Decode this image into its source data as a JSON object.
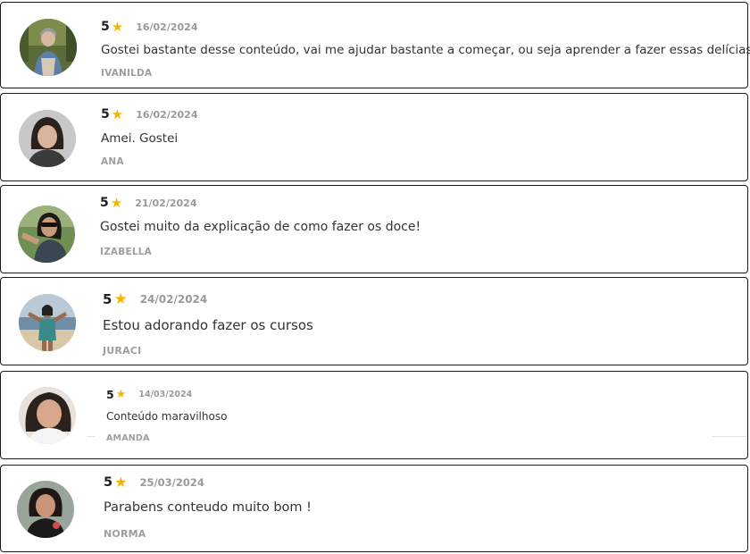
{
  "reviews": [
    {
      "rating": "5",
      "date": "16/02/2024",
      "text": "Gostei bastante desse conteúdo, vai me ajudar bastante a começar, ou seja aprender a fazer essas delícias",
      "author": "IVANILDA",
      "star_icon": "star-icon",
      "star_color": "#f4b400"
    },
    {
      "rating": "5",
      "date": "16/02/2024",
      "text": "Amei. Gostei",
      "author": "ANA",
      "star_icon": "star-icon",
      "star_color": "#f4b400"
    },
    {
      "rating": "5",
      "date": "21/02/2024",
      "text": "Gostei muito da explicação de como fazer os doce!",
      "author": "IZABELLA",
      "star_icon": "star-icon",
      "star_color": "#f4b400"
    },
    {
      "rating": "5",
      "date": "24/02/2024",
      "text": "Estou adorando fazer os cursos",
      "author": "JURACI",
      "star_icon": "star-icon",
      "star_color": "#f4b400"
    },
    {
      "rating": "5",
      "date": "14/03/2024",
      "text": "Conteúdo maravilhoso",
      "author": "AMANDA",
      "star_icon": "star-icon",
      "star_color": "#f4b400"
    },
    {
      "rating": "5",
      "date": "25/03/2024",
      "text": "Parabens conteudo muito bom !",
      "author": "NORMA",
      "star_icon": "star-icon",
      "star_color": "#f4b400"
    }
  ]
}
